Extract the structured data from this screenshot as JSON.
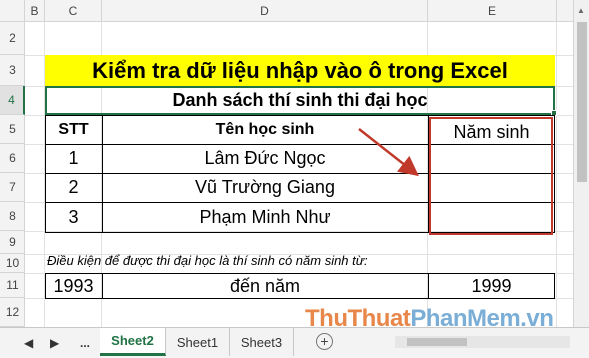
{
  "columns": [
    "B",
    "C",
    "D",
    "E"
  ],
  "rows": [
    "2",
    "3",
    "4",
    "5",
    "6",
    "7",
    "8",
    "9",
    "10",
    "11",
    "12"
  ],
  "title": "Kiểm tra dữ liệu nhập vào ô trong Excel",
  "subtitle": "Danh sách thí sinh thi đại học",
  "table": {
    "headers": [
      "STT",
      "Tên học sinh",
      "Năm sinh"
    ],
    "rows": [
      {
        "stt": "1",
        "name": "Lâm Đức Ngọc",
        "year": ""
      },
      {
        "stt": "2",
        "name": "Vũ Trường Giang",
        "year": ""
      },
      {
        "stt": "3",
        "name": "Phạm Minh Như",
        "year": ""
      }
    ]
  },
  "condition": "Điều kiện để được thi đại học là thí sinh có năm sinh từ:",
  "range": {
    "from": "1993",
    "mid": "đến năm",
    "to": "1999"
  },
  "tabs": [
    "Sheet2",
    "Sheet1",
    "Sheet3"
  ],
  "nav": {
    "prev": "◀",
    "next": "▶",
    "more": "..."
  },
  "watermark": {
    "part1": "ThuThuat",
    "part2": "PhanMem",
    "suffix": ".vn"
  },
  "colors": {
    "accent": "#217346",
    "title_bg": "#ffff00",
    "highlight": "#c0392b"
  }
}
